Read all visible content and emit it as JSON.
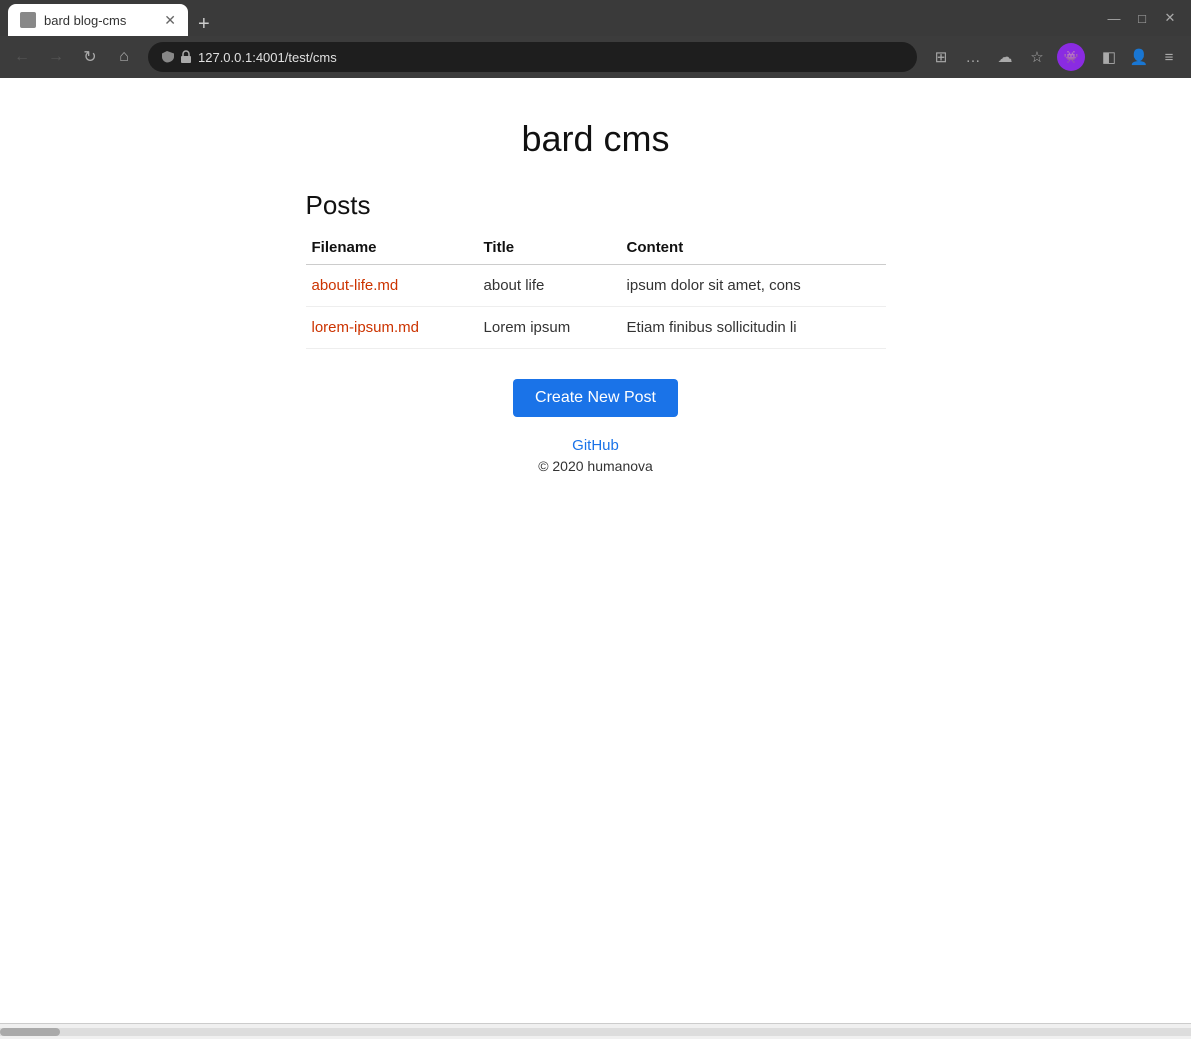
{
  "browser": {
    "tab_title": "bard blog-cms",
    "url": "127.0.0.1:4001/test/cms",
    "new_tab_label": "+",
    "nav": {
      "back_label": "←",
      "forward_label": "→",
      "refresh_label": "↻",
      "home_label": "⌂"
    },
    "toolbar_icons": [
      "≡",
      "…",
      "☆",
      "⊞",
      "◧",
      "👤"
    ],
    "window_buttons": {
      "minimize": "—",
      "maximize": "□",
      "close": "✕"
    }
  },
  "page": {
    "site_title": "bard cms",
    "posts_heading": "Posts",
    "table": {
      "columns": [
        "Filename",
        "Title",
        "Content"
      ],
      "rows": [
        {
          "filename": "about-life.md",
          "title": "about life",
          "content": "ipsum dolor sit amet, cons"
        },
        {
          "filename": "lorem-ipsum.md",
          "title": "Lorem ipsum",
          "content": "Etiam finibus sollicitudin li"
        }
      ]
    },
    "create_button": "Create New Post",
    "footer": {
      "github_label": "GitHub",
      "copyright": "© 2020 humanova"
    }
  }
}
